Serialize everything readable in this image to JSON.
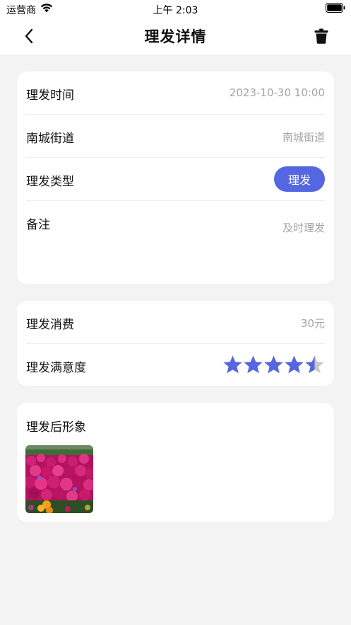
{
  "status": {
    "carrier": "运营商",
    "time": "上午 2:03"
  },
  "nav": {
    "title": "理发详情",
    "back_icon": "chevron-left-icon",
    "delete_icon": "trash-icon"
  },
  "details": {
    "time_label": "理发时间",
    "time_value": "2023-10-30 10:00",
    "location_label": "南城街道",
    "location_value": "南城街道",
    "type_label": "理发类型",
    "type_value": "理发",
    "note_label": "备注",
    "note_value": "及时理发"
  },
  "stats": {
    "cost_label": "理发消费",
    "cost_value": "30元",
    "satisfaction_label": "理发满意度",
    "satisfaction_rating": 4.5,
    "satisfaction_max": 5
  },
  "photo": {
    "title": "理发后形象",
    "image_subject": "pink-flowers-photo"
  },
  "colors": {
    "accent": "#5567e0",
    "star_filled": "#5567e0",
    "star_empty": "#c8c8c8",
    "secondary_text": "#a4a4a4",
    "background": "#f3f3f3"
  }
}
